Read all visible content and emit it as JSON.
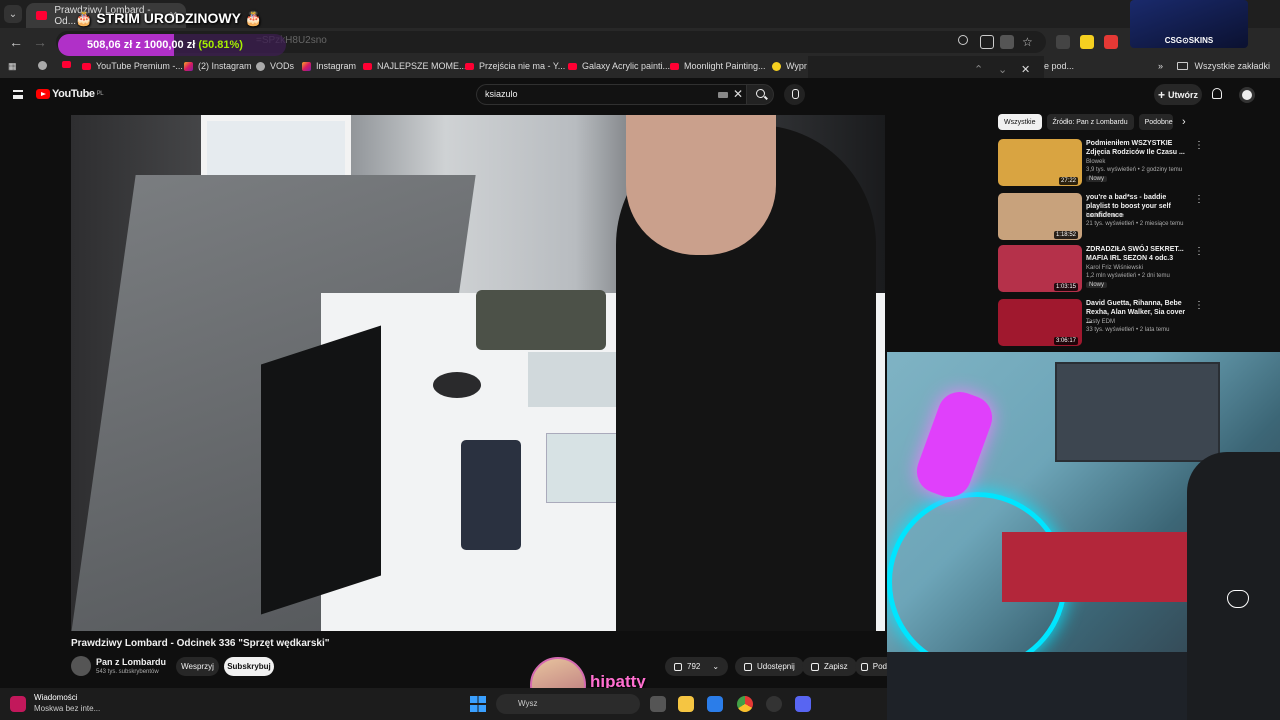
{
  "browser": {
    "tab_title": "Prawdziwy Lombard - Od...",
    "url_fragment": "=SPzkH8U2sno",
    "bookmarks": [
      "YouTube Premium -...",
      "(2) Instagram",
      "VODs",
      "Instagram",
      "NAJLEPSZE MOME...",
      "Przejścia nie ma - Y...",
      "Galaxy Acrylic painti...",
      "Moonlight Painting...",
      "Wypr"
    ],
    "bookmark_partial_right": "e pod...",
    "all_bookmarks": "Wszystkie zakładki"
  },
  "youtube": {
    "logo_text": "YouTube",
    "logo_region": "PL",
    "search_query": "ksiazulo",
    "create_label": "Utwórz",
    "video": {
      "title": "Prawdziwy Lombard - Odcinek 336 \"Sprzęt wędkarski\"",
      "channel": "Pan z Lombardu",
      "subscribers": "543 tys. subskrybentów",
      "support_label": "Wesprzyj",
      "subscribe_label": "Subskrybuj",
      "likes": "792",
      "share_label": "Udostępnij",
      "save_label": "Zapisz",
      "more_partial": "Pod"
    },
    "chips": [
      "Wszystkie",
      "Źródło: Pan z Lombardu",
      "Podobne"
    ],
    "recommendations": [
      {
        "title": "Podmieniłem WSZYSTKIE Zdjęcia Rodziców Ile Czasu ...",
        "channel": "Blowek",
        "meta": "3,9 tys. wyświetleń • 2 godziny temu",
        "badge": "Nowy",
        "duration": "27:22",
        "thumb_color": "#d9a441"
      },
      {
        "title": "you're a bad*ss - baddie playlist to boost your self confidence",
        "channel": "baddie femme",
        "meta": "21 tys. wyświetleń • 2 miesiące temu",
        "badge": "",
        "duration": "1:18:52",
        "thumb_color": "#c8a27c"
      },
      {
        "title": "ZDRADZIŁA SWÓJ SEKRET... MAFIA IRL SEZON 4 odc.3",
        "channel": "Karol Friz Wiśniewski",
        "meta": "1,2 mln wyświetleń • 2 dni temu",
        "badge": "Nowy",
        "duration": "1:03:15",
        "thumb_color": "#b5314a"
      },
      {
        "title": "David Guetta, Rihanna, Bebe Rexha, Alan Walker, Sia cover ...",
        "channel": "Tasty EDM",
        "meta": "33 tys. wyświetleń • 2 lata temu",
        "badge": "",
        "duration": "3:06:17",
        "thumb_color": "#a0182e"
      }
    ]
  },
  "overlay": {
    "stream_title": "🎂 STRIM URODZINOWY 🎂",
    "goal_text": "508,06 zł z 1000,00 zł",
    "goal_percent": "(50.81%)",
    "goal_fraction": 0.5081,
    "sponsor": "CSG⊙SKINS",
    "viewer_name": "hipatty"
  },
  "taskbar": {
    "news_title": "Wiadomości",
    "news_sub": "Moskwa bez inte...",
    "search_placeholder": "Wysz"
  }
}
